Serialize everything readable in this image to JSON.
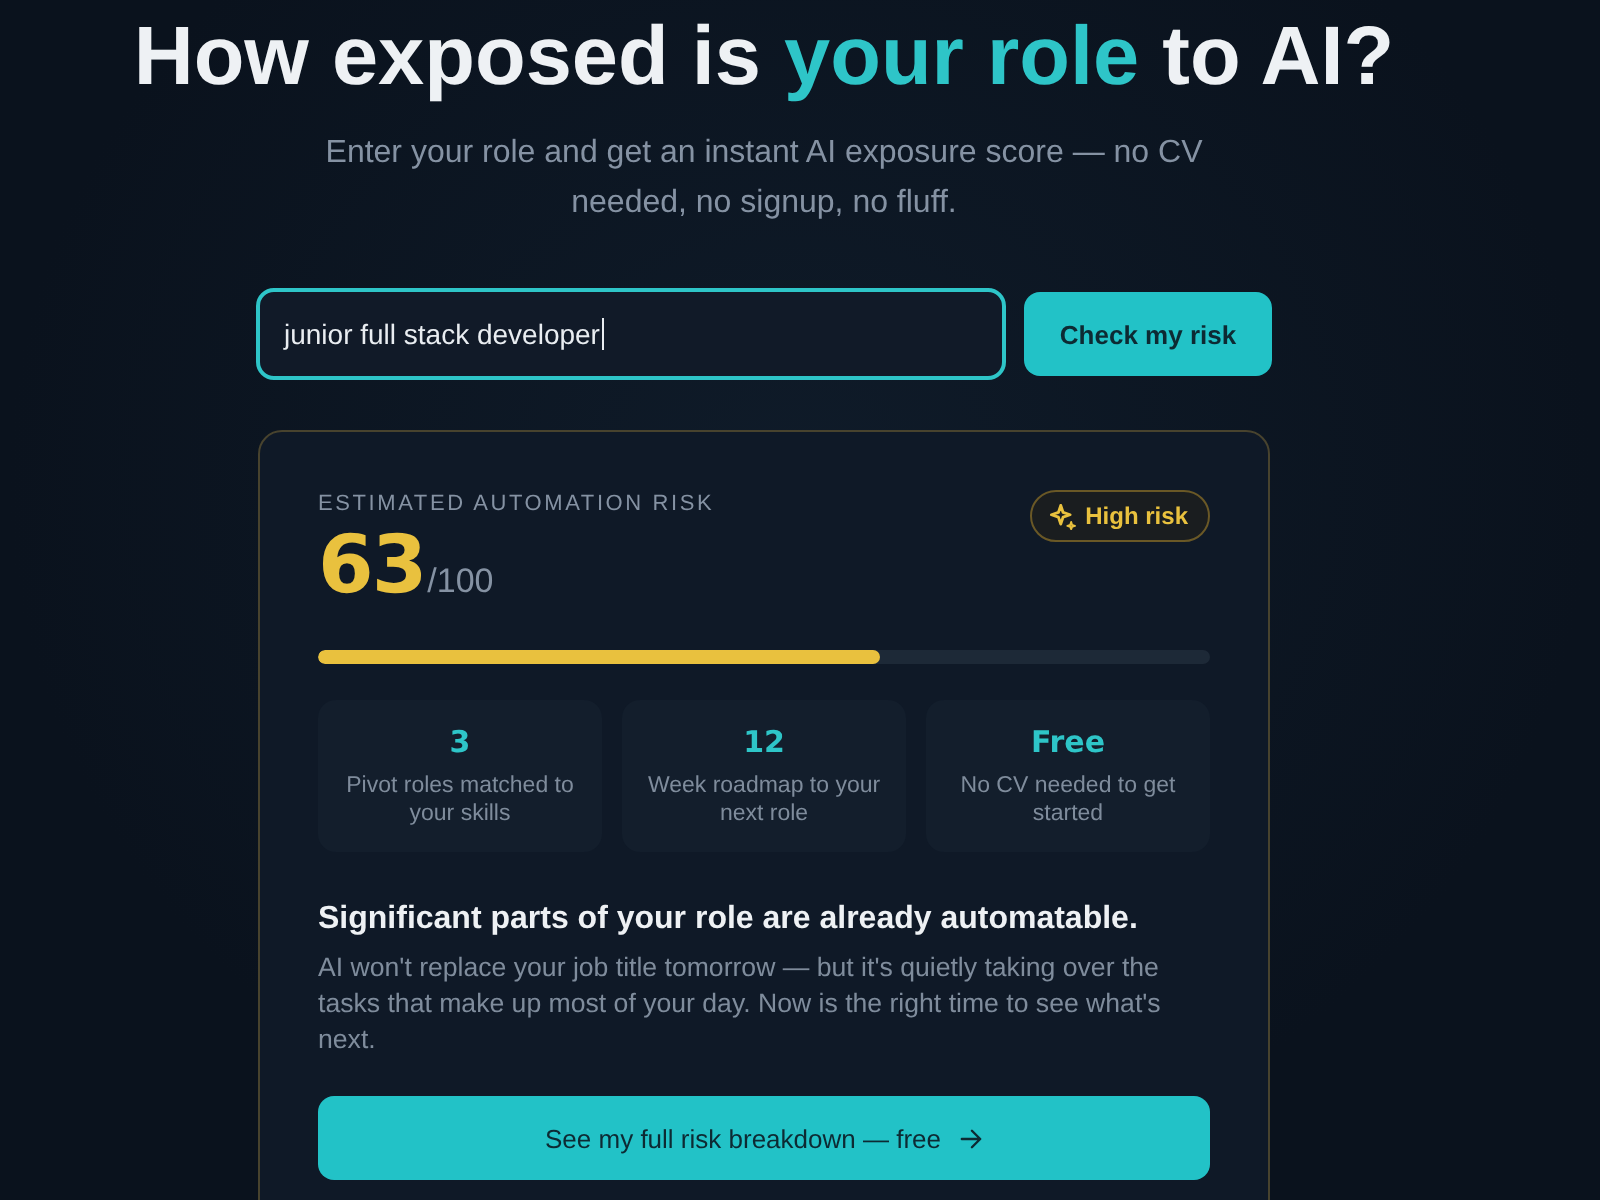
{
  "headline": {
    "segments": [
      {
        "text": "How exposed is ",
        "highlight": false
      },
      {
        "text": "your role",
        "highlight": true
      },
      {
        "text": " to AI?",
        "highlight": false
      }
    ]
  },
  "subtitle": "Enter your role and get an instant AI exposure score — no CV needed, no signup, no fluff.",
  "search": {
    "value": "junior full stack developer",
    "focused": true
  },
  "check_button": "Check my risk",
  "result": {
    "label": "ESTIMATED AUTOMATION RISK",
    "score": "63",
    "out_of": "/100",
    "badge": "High risk",
    "level": 0.63,
    "stats": [
      {
        "value": "3",
        "caption": "Pivot roles matched to your skills"
      },
      {
        "value": "12",
        "caption": "Week roadmap to your next role"
      },
      {
        "value": "Free",
        "caption": "No CV needed to get started"
      }
    ],
    "heading": "Significant parts of your role are already automatable.",
    "body": "AI won't replace your job title tomorrow — but it's quietly taking over the tasks that make up most of your day. Now is the right time to see what's next.",
    "cta": "See my full risk breakdown — free"
  }
}
